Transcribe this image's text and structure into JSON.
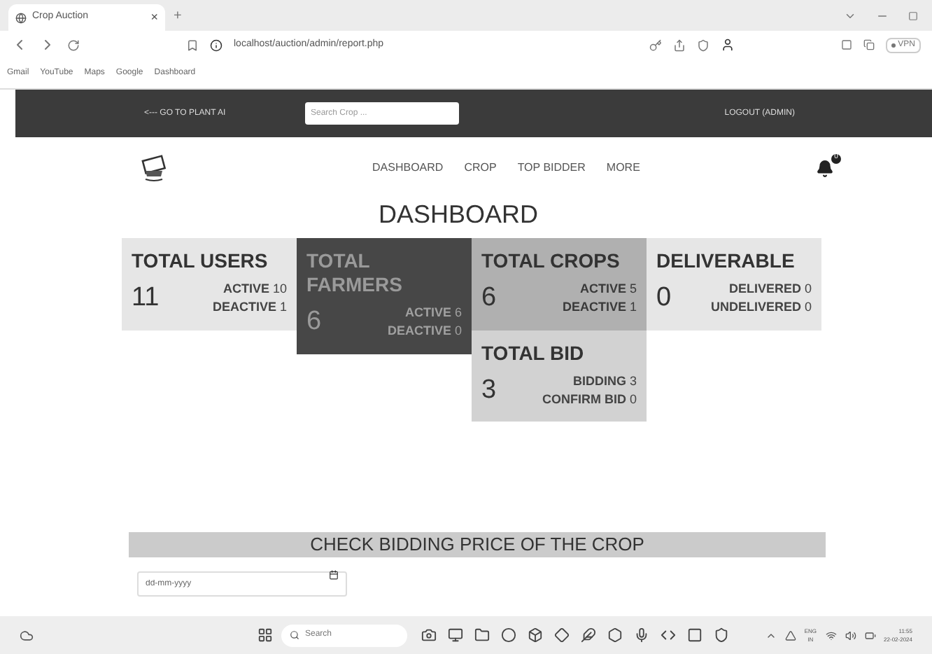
{
  "browser": {
    "tab": {
      "title": "Crop Auction",
      "close": "×",
      "new_tab": "+"
    },
    "url": "localhost/auction/admin/report.php",
    "bookmarks": [
      "Gmail",
      "YouTube",
      "Maps",
      "Google",
      "Dashboard"
    ],
    "vpn": "VPN"
  },
  "topbar": {
    "back_link": "<--- GO TO PLANT AI",
    "search": {
      "placeholder": "Search Crop ..."
    },
    "logout": "LOGOUT (ADMIN)"
  },
  "nav": {
    "items": [
      "DASHBOARD",
      "CROP",
      "TOP BIDDER",
      "MORE"
    ],
    "notifications": "0"
  },
  "title": "DASHBOARD",
  "columns": [
    [
      {
        "kind": "light",
        "title": "TOTAL USERS",
        "count": "11",
        "stats": [
          {
            "label": "ACTIVE",
            "value": "10"
          },
          {
            "label": "DEACTIVE",
            "value": "1"
          }
        ]
      }
    ],
    [
      {
        "kind": "dark",
        "title": "TOTAL FARMERS",
        "count": "6",
        "stats": [
          {
            "label": "ACTIVE",
            "value": "6"
          },
          {
            "label": "DEACTIVE",
            "value": "0"
          }
        ]
      }
    ],
    [
      {
        "kind": "mid",
        "title": "TOTAL CROPS",
        "count": "6",
        "stats": [
          {
            "label": "ACTIVE",
            "value": "5"
          },
          {
            "label": "DEACTIVE",
            "value": "1"
          }
        ]
      },
      {
        "kind": "soft",
        "title": "TOTAL BID",
        "count": "3",
        "stats": [
          {
            "label": "BIDDING",
            "value": "3"
          },
          {
            "label": "CONFIRM BID",
            "value": "0"
          }
        ]
      }
    ],
    [
      {
        "kind": "light",
        "title": "DELIVERABLE",
        "count": "0",
        "stats": [
          {
            "label": "DELIVERED",
            "value": "0"
          },
          {
            "label": "UNDELIVERED",
            "value": "0"
          }
        ]
      }
    ]
  ],
  "bidding": {
    "heading": "CHECK BIDDING PRICE OF THE CROP",
    "date": {
      "placeholder": "dd-mm-yyyy"
    }
  },
  "taskbar": {
    "search": {
      "placeholder": "Search"
    },
    "language": "ENG",
    "region": "IN",
    "time": "11:55",
    "date": "22-02-2024"
  }
}
